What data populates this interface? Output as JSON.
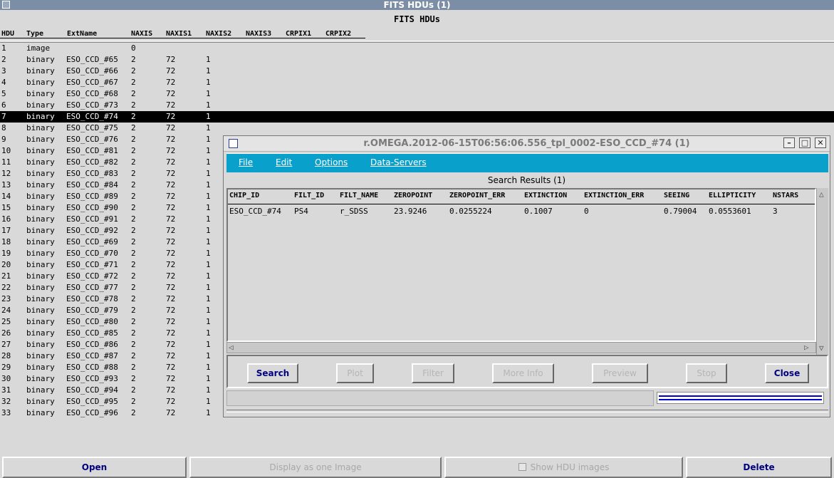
{
  "window": {
    "title": "FITS HDUs (1)"
  },
  "heading": "FITS HDUs",
  "columns": [
    "HDU",
    "Type",
    "ExtName",
    "NAXIS",
    "NAXIS1",
    "NAXIS2",
    "NAXIS3",
    "CRPIX1",
    "CRPIX2"
  ],
  "rows": [
    [
      "1",
      "image",
      "",
      "0",
      "",
      ""
    ],
    [
      "2",
      "binary",
      "ESO_CCD_#65",
      "2",
      "72",
      "1"
    ],
    [
      "3",
      "binary",
      "ESO_CCD_#66",
      "2",
      "72",
      "1"
    ],
    [
      "4",
      "binary",
      "ESO_CCD_#67",
      "2",
      "72",
      "1"
    ],
    [
      "5",
      "binary",
      "ESO_CCD_#68",
      "2",
      "72",
      "1"
    ],
    [
      "6",
      "binary",
      "ESO_CCD_#73",
      "2",
      "72",
      "1"
    ],
    [
      "7",
      "binary",
      "ESO_CCD_#74",
      "2",
      "72",
      "1"
    ],
    [
      "8",
      "binary",
      "ESO_CCD_#75",
      "2",
      "72",
      "1"
    ],
    [
      "9",
      "binary",
      "ESO_CCD_#76",
      "2",
      "72",
      "1"
    ],
    [
      "10",
      "binary",
      "ESO_CCD_#81",
      "2",
      "72",
      "1"
    ],
    [
      "11",
      "binary",
      "ESO_CCD_#82",
      "2",
      "72",
      "1"
    ],
    [
      "12",
      "binary",
      "ESO_CCD_#83",
      "2",
      "72",
      "1"
    ],
    [
      "13",
      "binary",
      "ESO_CCD_#84",
      "2",
      "72",
      "1"
    ],
    [
      "14",
      "binary",
      "ESO_CCD_#89",
      "2",
      "72",
      "1"
    ],
    [
      "15",
      "binary",
      "ESO_CCD_#90",
      "2",
      "72",
      "1"
    ],
    [
      "16",
      "binary",
      "ESO_CCD_#91",
      "2",
      "72",
      "1"
    ],
    [
      "17",
      "binary",
      "ESO_CCD_#92",
      "2",
      "72",
      "1"
    ],
    [
      "18",
      "binary",
      "ESO_CCD_#69",
      "2",
      "72",
      "1"
    ],
    [
      "19",
      "binary",
      "ESO_CCD_#70",
      "2",
      "72",
      "1"
    ],
    [
      "20",
      "binary",
      "ESO_CCD_#71",
      "2",
      "72",
      "1"
    ],
    [
      "21",
      "binary",
      "ESO_CCD_#72",
      "2",
      "72",
      "1"
    ],
    [
      "22",
      "binary",
      "ESO_CCD_#77",
      "2",
      "72",
      "1"
    ],
    [
      "23",
      "binary",
      "ESO_CCD_#78",
      "2",
      "72",
      "1"
    ],
    [
      "24",
      "binary",
      "ESO_CCD_#79",
      "2",
      "72",
      "1"
    ],
    [
      "25",
      "binary",
      "ESO_CCD_#80",
      "2",
      "72",
      "1"
    ],
    [
      "26",
      "binary",
      "ESO_CCD_#85",
      "2",
      "72",
      "1"
    ],
    [
      "27",
      "binary",
      "ESO_CCD_#86",
      "2",
      "72",
      "1"
    ],
    [
      "28",
      "binary",
      "ESO_CCD_#87",
      "2",
      "72",
      "1"
    ],
    [
      "29",
      "binary",
      "ESO_CCD_#88",
      "2",
      "72",
      "1"
    ],
    [
      "30",
      "binary",
      "ESO_CCD_#93",
      "2",
      "72",
      "1"
    ],
    [
      "31",
      "binary",
      "ESO_CCD_#94",
      "2",
      "72",
      "1"
    ],
    [
      "32",
      "binary",
      "ESO_CCD_#95",
      "2",
      "72",
      "1"
    ],
    [
      "33",
      "binary",
      "ESO_CCD_#96",
      "2",
      "72",
      "1"
    ]
  ],
  "selected_hdu": "7",
  "bottom_buttons": {
    "open": "Open",
    "display_one": "Display as one Image",
    "show_hdu": "Show HDU images",
    "delete": "Delete"
  },
  "dialog": {
    "title": "r.OMEGA.2012-06-15T06:56:06.556_tpl_0002-ESO_CCD_#74 (1)",
    "menus": [
      "File",
      "Edit",
      "Options",
      "Data-Servers"
    ],
    "results_label": "Search Results (1)",
    "columns": [
      "CHIP_ID",
      "FILT_ID",
      "FILT_NAME",
      "ZEROPOINT",
      "ZEROPOINT_ERR",
      "EXTINCTION",
      "EXTINCTION_ERR",
      "SEEING",
      "ELLIPTICITY",
      "NSTARS"
    ],
    "row": [
      "ESO_CCD_#74",
      "PS4",
      "r_SDSS",
      "23.9246",
      "0.0255224",
      "0.1007",
      "0",
      "0.79004",
      "0.0553601",
      "3"
    ],
    "buttons": [
      "Search",
      "Plot",
      "Filter",
      "More Info",
      "Preview",
      "Stop",
      "Close"
    ],
    "enabled_buttons": [
      "Search",
      "Close"
    ]
  }
}
